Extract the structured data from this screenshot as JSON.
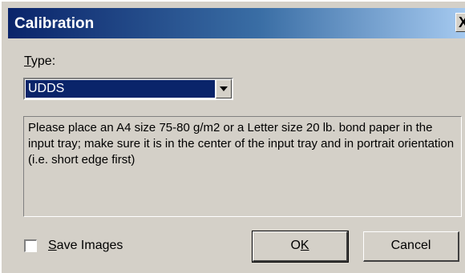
{
  "window": {
    "title": "Calibration",
    "close_glyph": "X"
  },
  "type_field": {
    "label_prefix": "T",
    "label_rest": "ype:",
    "selected_value": "UDDS"
  },
  "message": "Please place an A4 size 75-80 g/m2 or a Letter size 20 lb. bond paper in the input tray; make sure it is in the center of the input tray and in portrait orientation (i.e. short edge first)",
  "save_images": {
    "label_prefix": "S",
    "label_rest": "ave Images",
    "checked": false
  },
  "buttons": {
    "ok_prefix": "O",
    "ok_underlined": "K",
    "cancel": "Cancel"
  },
  "colors": {
    "titlebar_start": "#0a246a",
    "titlebar_end": "#a6caf0",
    "dialog_bg": "#d4d0c8",
    "selection_bg": "#0a246a"
  }
}
